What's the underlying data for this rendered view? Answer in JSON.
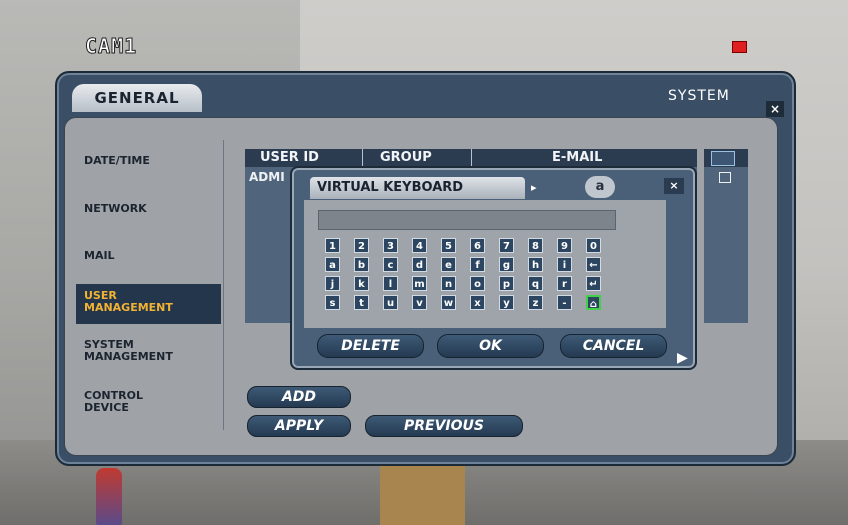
{
  "camera": {
    "title": "CAM1",
    "rec_color": "#e02020"
  },
  "panel": {
    "tab": "GENERAL",
    "title": "SYSTEM",
    "close": "×"
  },
  "menu": [
    {
      "id": "date-time",
      "label": "DATE/TIME"
    },
    {
      "id": "network",
      "label": "NETWORK"
    },
    {
      "id": "mail",
      "label": "MAIL"
    },
    {
      "id": "user-management",
      "label": "USER\nMANAGEMENT",
      "active": true
    },
    {
      "id": "system-management",
      "label": "SYSTEM\nMANAGEMENT"
    },
    {
      "id": "control-device",
      "label": "CONTROL\nDEVICE"
    }
  ],
  "table": {
    "columns": [
      "USER ID",
      "GROUP",
      "E-MAIL"
    ],
    "rows": [
      {
        "user_id": "ADMI"
      }
    ]
  },
  "buttons": {
    "add": "ADD",
    "apply": "APPLY",
    "previous": "PREVIOUS"
  },
  "keyboard": {
    "title": "VIRTUAL KEYBOARD",
    "mode": "a",
    "arrow": "▸",
    "close": "×",
    "input_value": "",
    "rows": [
      [
        "1",
        "2",
        "3",
        "4",
        "5",
        "6",
        "7",
        "8",
        "9",
        "0"
      ],
      [
        "a",
        "b",
        "c",
        "d",
        "e",
        "f",
        "g",
        "h",
        "i",
        "←"
      ],
      [
        "j",
        "k",
        "l",
        "m",
        "n",
        "o",
        "p",
        "q",
        "r",
        "↵"
      ],
      [
        "s",
        "t",
        "u",
        "v",
        "w",
        "x",
        "y",
        "z",
        "-",
        "⌂"
      ]
    ],
    "selected_key": "⌂",
    "delete": "DELETE",
    "ok": "OK",
    "cancel": "CANCEL"
  },
  "colors": {
    "accent": "#f2b233",
    "panel": "#3a4f66",
    "selection": "#43d14a"
  }
}
